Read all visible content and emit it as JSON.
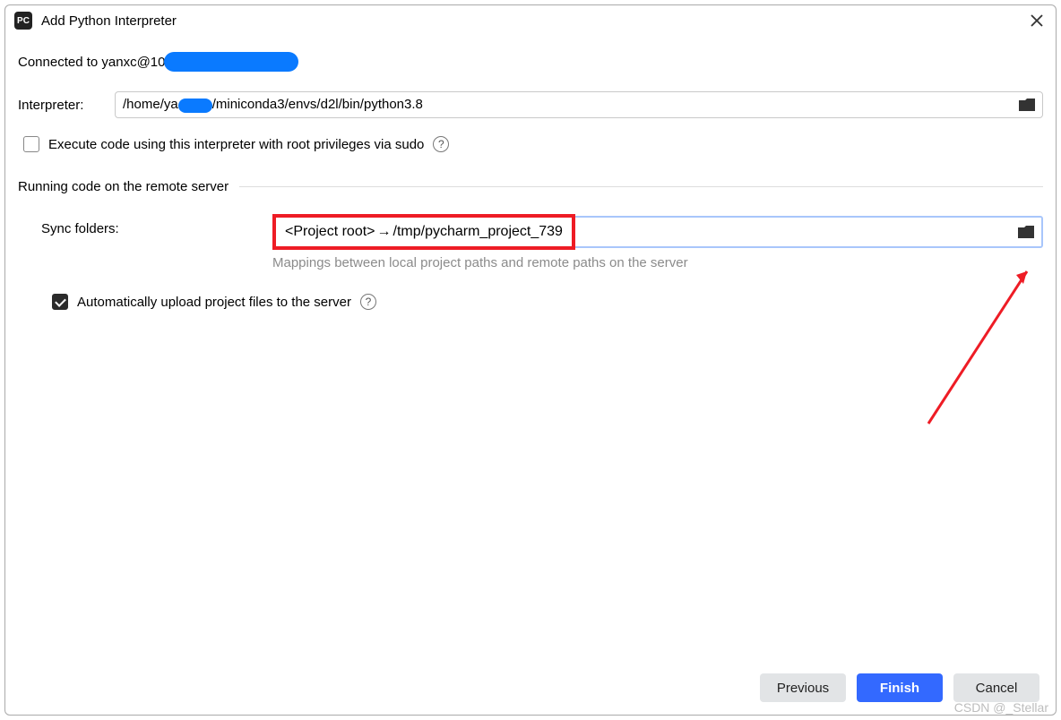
{
  "titlebar": {
    "title": "Add Python Interpreter"
  },
  "connected": {
    "prefix": "Connected to yanxc@10"
  },
  "interpreter": {
    "label": "Interpreter:",
    "path_prefix": "/home/ya",
    "path_suffix": "/miniconda3/envs/d2l/bin/python3.8"
  },
  "sudo": {
    "label": "Execute code using this interpreter with root privileges via sudo"
  },
  "section": {
    "label": "Running code on the remote server"
  },
  "sync": {
    "label": "Sync folders:",
    "local": "<Project root>",
    "remote": "/tmp/pycharm_project_739",
    "help": "Mappings between local project paths and remote paths on the server"
  },
  "auto_upload": {
    "label": "Automatically upload project files to the server"
  },
  "buttons": {
    "previous": "Previous",
    "finish": "Finish",
    "cancel": "Cancel"
  },
  "watermark": "CSDN @_Stellar"
}
